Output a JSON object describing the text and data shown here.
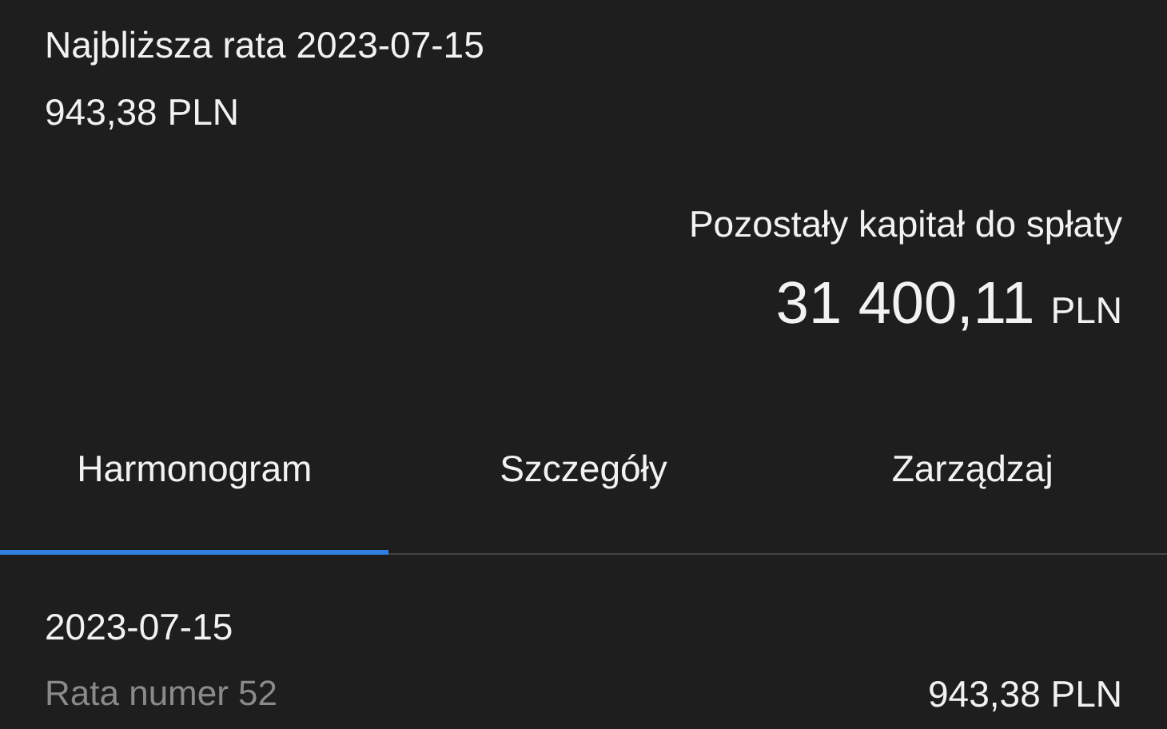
{
  "next_installment": {
    "label": "Najbliższa rata 2023-07-15",
    "amount": "943,38 PLN"
  },
  "remaining": {
    "label": "Pozostały kapitał do spłaty",
    "amount": "31 400,11",
    "currency": "PLN"
  },
  "tabs": [
    {
      "label": "Harmonogram",
      "selected": true
    },
    {
      "label": "Szczegóły",
      "selected": false
    },
    {
      "label": "Zarządzaj",
      "selected": false
    }
  ],
  "schedule": [
    {
      "date": "2023-07-15",
      "description": "Rata numer 52",
      "amount": "943,38 PLN"
    }
  ]
}
